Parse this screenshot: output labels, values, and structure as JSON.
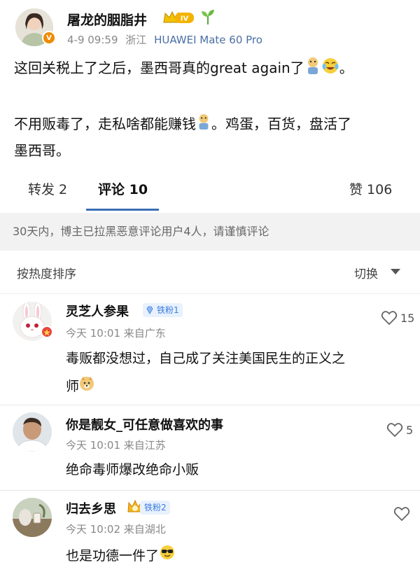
{
  "post": {
    "author": "屠龙的胭脂井",
    "level_badge": "IV",
    "verified_mark": "V",
    "date": "4-9 09:59",
    "location": "浙江",
    "device": "HUAWEI Mate 60 Pro",
    "line1": "这回关税上了之后，墨西哥真的great again了",
    "line1_end": "。",
    "line2": "不用贩毒了，走私啥都能赚钱",
    "line2_end": "。鸡蛋，百货，盘活了",
    "line3": "墨西哥。"
  },
  "tabs": {
    "repost": "转发 2",
    "comments": "评论 10",
    "likes": "赞 106"
  },
  "notice": "30天内，博主已拉黑恶意评论用户4人，请谨慎评论",
  "sort": {
    "label": "按热度排序",
    "switch": "切换"
  },
  "comments": [
    {
      "name": "灵芝人参果",
      "badge": "铁粉1",
      "time": "今天 10:01 来自广东",
      "text1": "毒贩都没想过，自己成了关注美国民生的正义之",
      "text2": "师",
      "likes": "15"
    },
    {
      "name": "你是靓女_可任意做喜欢的事",
      "badge": "",
      "time": "今天 10:01 来自江苏",
      "text1": "绝命毒师爆改绝命小贩",
      "text2": "",
      "likes": "5"
    },
    {
      "name": "归去乡思",
      "badge": "铁粉2",
      "time": "今天 10:02 来自湖北",
      "text1": "也是功德一件了",
      "text2": "",
      "likes": ""
    }
  ],
  "colors": {
    "accent": "#3b6fb6",
    "badge_bg": "#e8f1fd",
    "badge_text": "#3b7be0",
    "verified": "#f08a00"
  }
}
